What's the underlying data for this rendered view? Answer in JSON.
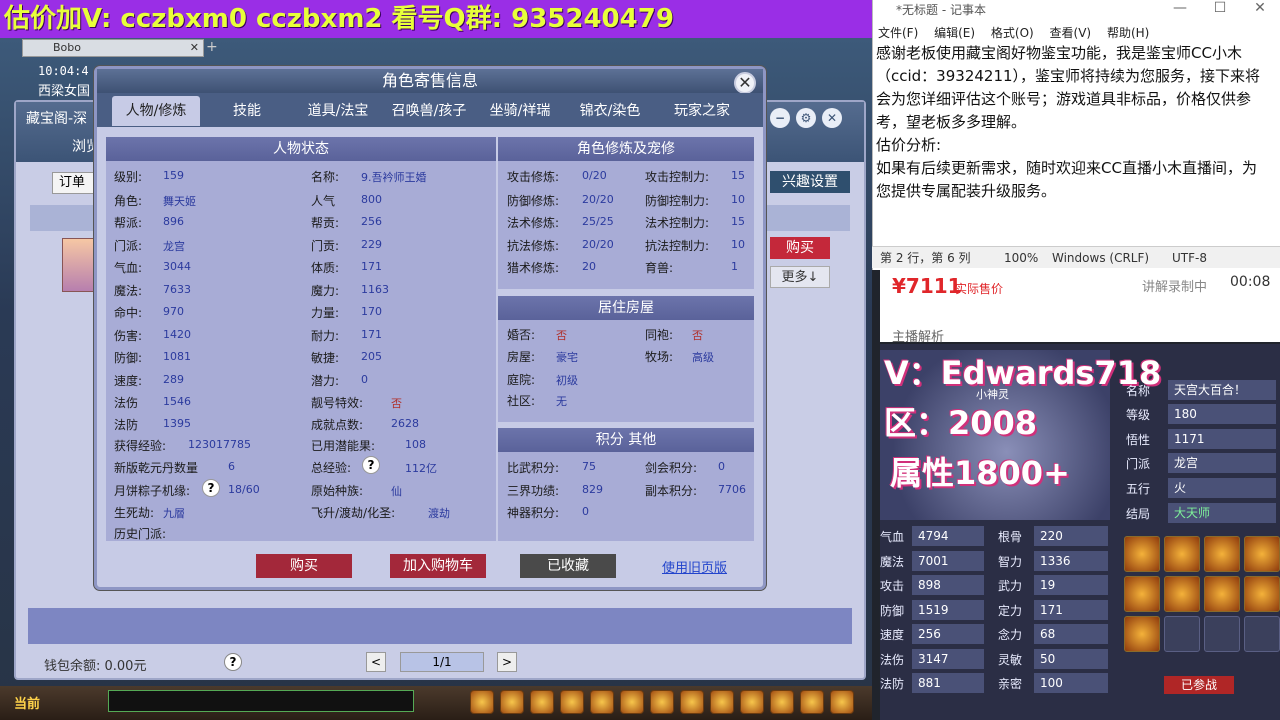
{
  "banner": "估价加V:  cczbxm0  cczbxm2  看号Q群:  935240479",
  "game": {
    "clock": "10:04:4",
    "place": "西梁女国",
    "browser_tab": "Bobo",
    "cbg_title": "藏宝阁-深",
    "cbg_nav": "浏览",
    "order_btn": "订单",
    "interest_btn": "兴趣设置",
    "buy_btn": "购买",
    "more_btn": "更多↓",
    "wallet": "钱包余额: 0.00元",
    "help": "?",
    "pager": "1/1",
    "prev": "<",
    "next": ">",
    "bottom_label": "当前"
  },
  "modal": {
    "title": "角色寄售信息",
    "close": "✕",
    "tabs": [
      "人物/修炼",
      "技能",
      "道具/法宝",
      "召唤兽/孩子",
      "坐骑/祥瑞",
      "锦衣/染色",
      "玩家之家"
    ],
    "status_head": "人物状态",
    "left_col": [
      {
        "label": "级别:",
        "value": "159"
      },
      {
        "label": "角色:",
        "value": "舞天姬"
      },
      {
        "label": "帮派:",
        "value": "896"
      },
      {
        "label": "门派:",
        "value": "龙宫"
      },
      {
        "label": "气血:",
        "value": "3044"
      },
      {
        "label": "魔法:",
        "value": "7633"
      },
      {
        "label": "命中:",
        "value": "970"
      },
      {
        "label": "伤害:",
        "value": "1420"
      },
      {
        "label": "防御:",
        "value": "1081"
      },
      {
        "label": "速度:",
        "value": "289"
      },
      {
        "label": "法伤",
        "value": "1546"
      },
      {
        "label": "法防",
        "value": "1395"
      },
      {
        "label": "获得经验:",
        "value": "123017785"
      },
      {
        "label": "新版乾元丹数量",
        "value": "6"
      },
      {
        "label": "月饼粽子机缘:",
        "value": "18/60"
      },
      {
        "label": "生死劫:",
        "value": "九層"
      },
      {
        "label": "历史门派:",
        "value": ""
      }
    ],
    "mid_col": [
      {
        "label": "名称:",
        "value": "9.吾衿师王婚"
      },
      {
        "label": "人气",
        "value": "800"
      },
      {
        "label": "帮贡:",
        "value": "256"
      },
      {
        "label": "门贡:",
        "value": "229"
      },
      {
        "label": "体质:",
        "value": "171"
      },
      {
        "label": "魔力:",
        "value": "1163"
      },
      {
        "label": "力量:",
        "value": "170"
      },
      {
        "label": "耐力:",
        "value": "171"
      },
      {
        "label": "敏捷:",
        "value": "205"
      },
      {
        "label": "潜力:",
        "value": "0"
      },
      {
        "label": "靓号特效:",
        "value": "否"
      },
      {
        "label": "成就点数:",
        "value": "2628"
      },
      {
        "label": "已用潜能果:",
        "value": "108"
      },
      {
        "label": "总经验:",
        "value": "112亿"
      },
      {
        "label": "原始种族:",
        "value": "仙"
      },
      {
        "label": "飞升/渡劫/化圣:",
        "value": "渡劫"
      }
    ],
    "cult_head": "角色修炼及宠修",
    "cult_left": [
      {
        "label": "攻击修炼:",
        "value": "0/20"
      },
      {
        "label": "防御修炼:",
        "value": "20/20"
      },
      {
        "label": "法术修炼:",
        "value": "25/25"
      },
      {
        "label": "抗法修炼:",
        "value": "20/20"
      },
      {
        "label": "猎术修炼:",
        "value": "20"
      }
    ],
    "cult_right": [
      {
        "label": "攻击控制力:",
        "value": "15"
      },
      {
        "label": "防御控制力:",
        "value": "10"
      },
      {
        "label": "法术控制力:",
        "value": "15"
      },
      {
        "label": "抗法控制力:",
        "value": "10"
      },
      {
        "label": "育兽:",
        "value": "1"
      }
    ],
    "house_head": "居住房屋",
    "house_left": [
      {
        "label": "婚否:",
        "value": "否"
      },
      {
        "label": "房屋:",
        "value": "豪宅"
      },
      {
        "label": "庭院:",
        "value": "初级"
      },
      {
        "label": "社区:",
        "value": "无"
      }
    ],
    "house_right": [
      {
        "label": "同袍:",
        "value": "否"
      },
      {
        "label": "牧场:",
        "value": "高级"
      }
    ],
    "score_head": "积分 其他",
    "score_left": [
      {
        "label": "比武积分:",
        "value": "75"
      },
      {
        "label": "三界功绩:",
        "value": "829"
      },
      {
        "label": "神器积分:",
        "value": "0"
      }
    ],
    "score_right": [
      {
        "label": "剑会积分:",
        "value": "0"
      },
      {
        "label": "副本积分:",
        "value": "7706"
      }
    ],
    "buttons": {
      "buy": "购买",
      "cart": "加入购物车",
      "fav": "已收藏",
      "old": "使用旧页版"
    }
  },
  "notepad": {
    "title": "*无标题 - 记事本",
    "menu": [
      "文件(F)",
      "编辑(E)",
      "格式(O)",
      "查看(V)",
      "帮助(H)"
    ],
    "text": "感谢老板使用藏宝阁好物鉴宝功能，我是鉴宝师CC小木（ccid：39324211），鉴宝师将持续为您服务，接下来将会为您详细评估这个账号；游戏道具非标品，价格仅供参考，望老板多多理解。\n估价分析:\n如果有后续更新需求，随时欢迎来CC直播小木直播间，为您提供专属配装升级服务。",
    "status": {
      "pos": "第 2 行，第 6 列",
      "zoom": "100%",
      "eol": "Windows (CRLF)",
      "enc": "UTF-8"
    }
  },
  "stream": {
    "price": "¥7111",
    "price_sub": "实际售价",
    "rec_status": "讲解录制中",
    "rec_time": "00:08",
    "anchor": "主播解析",
    "overlay_v": "V：Edwards718",
    "overlay_zone": "区：2008",
    "overlay_attr": "属性1800+",
    "pet_name": "小神灵",
    "right_fields": [
      {
        "label": "名称",
        "value": "天宫大百合！"
      },
      {
        "label": "等级",
        "value": "180"
      },
      {
        "label": "悟性",
        "value": "1171"
      },
      {
        "label": "门派",
        "value": "龙宫"
      },
      {
        "label": "五行",
        "value": "火"
      },
      {
        "label": "结局",
        "value": "大天师"
      }
    ],
    "stats_left": [
      {
        "label": "气血",
        "value": "4794"
      },
      {
        "label": "魔法",
        "value": "7001"
      },
      {
        "label": "攻击",
        "value": "898"
      },
      {
        "label": "防御",
        "value": "1519"
      },
      {
        "label": "速度",
        "value": "256"
      },
      {
        "label": "法伤",
        "value": "3147"
      },
      {
        "label": "法防",
        "value": "881"
      }
    ],
    "stats_right": [
      {
        "label": "根骨",
        "value": "220"
      },
      {
        "label": "智力",
        "value": "1336"
      },
      {
        "label": "武力",
        "value": "19"
      },
      {
        "label": "定力",
        "value": "171"
      },
      {
        "label": "念力",
        "value": "68"
      },
      {
        "label": "灵敏",
        "value": "50"
      },
      {
        "label": "亲密",
        "value": "100"
      }
    ],
    "battle_btn": "已参战"
  }
}
